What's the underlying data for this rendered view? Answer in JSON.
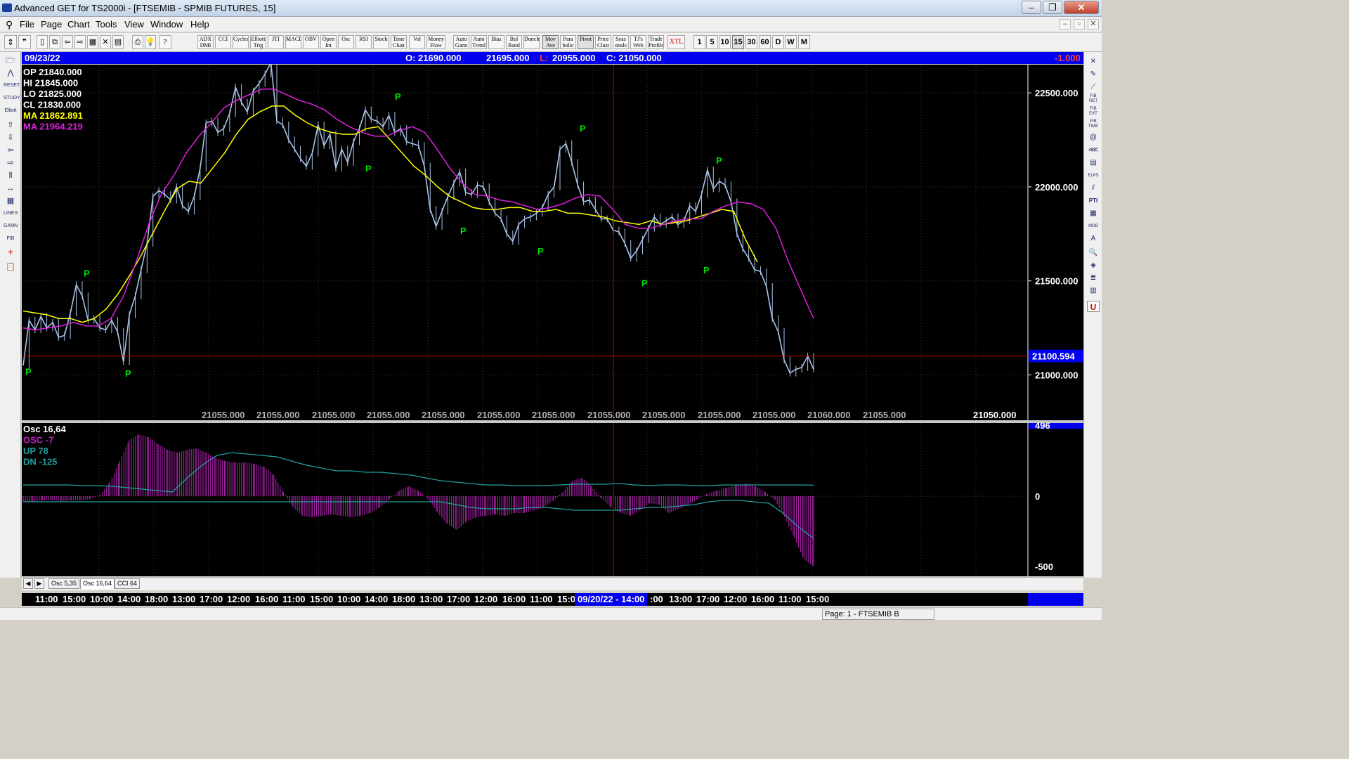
{
  "window": {
    "title": "Advanced GET for TS2000i - [FTSEMIB - SPMIB FUTURES, 15]"
  },
  "menu": [
    "File",
    "Page",
    "Chart",
    "Tools",
    "View",
    "Window",
    "Help"
  ],
  "toolbar": {
    "indicators": [
      "ADX DMI",
      "CCI",
      "Cycles",
      "Elliott Trig",
      "JTI",
      "MACD",
      "OBV",
      "Open Int",
      "Osc",
      "RSI",
      "Stoch",
      "Time Clust",
      "Vol",
      "Money Flow",
      "Auto Gann",
      "Auto Trend",
      "Bias",
      "Bol Band",
      "Donch",
      "Mov Ave",
      "Para bolic",
      "Pivot",
      "Price Clust",
      "Seas onals",
      "TJ's Web",
      "Trade Profile",
      "XTL"
    ],
    "intervals": [
      "1",
      "5",
      "10",
      "15",
      "30",
      "60",
      "D",
      "W",
      "M"
    ],
    "active_interval": "15"
  },
  "infobar": {
    "date": "09/23/22",
    "open": "O: 21690.000",
    "high": "21695.000",
    "low_label": "L:",
    "low_value": "20955.000",
    "close": "C: 21050.000",
    "change": "-1.000"
  },
  "legend": {
    "op": "OP  21840.000",
    "hi": "HI   21845.000",
    "lo": "LO  21825.000",
    "cl": "CL  21830.000",
    "ma1": "MA  21862.891",
    "ma2": "MA  21964.219"
  },
  "colors": {
    "price": "#a9c4e8",
    "ma_fast": "#ffff00",
    "ma_slow": "#e020e0",
    "pivot": "#00e000",
    "hist": "#a020a0",
    "band": "#20a0a0",
    "cursor": "#c00000"
  },
  "chart_data": [
    {
      "type": "line",
      "title": "FTSEMIB - SPMIB FUTURES, 15",
      "ylim": [
        20800,
        22650
      ],
      "yticks": [
        "22500.000",
        "22000.000",
        "21500.000",
        "21000.000"
      ],
      "ytick_values": [
        22500,
        22000,
        21500,
        21000
      ],
      "cursor_price_label": "21100.594",
      "cursor_price": 21100.594,
      "bottom_labels": [
        "21055.000",
        "21055.000",
        "21055.000",
        "21055.000",
        "21055.000",
        "21055.000",
        "21055.000",
        "21055.000",
        "21055.000",
        "21055.000",
        "21055.000",
        "21060.000",
        "21055.000",
        "21050.000"
      ],
      "series": [
        {
          "name": "",
          "values": [
            21050,
            21290,
            21240,
            21310,
            21250,
            21280,
            21200,
            21210,
            21330,
            21480,
            21420,
            21290,
            21300,
            21250,
            21240,
            21290,
            21230,
            21070,
            21320,
            21420,
            21560,
            21700,
            21950,
            21980,
            21960,
            21930,
            22000,
            21900,
            21870,
            21950,
            22100,
            22340,
            22350,
            22290,
            22310,
            22390,
            22530,
            22450,
            22400,
            22510,
            22550,
            22600,
            22660,
            22350,
            22330,
            22250,
            22200,
            22150,
            22110,
            22180,
            22330,
            22220,
            22280,
            22100,
            22200,
            22130,
            22240,
            22310,
            22410,
            22360,
            22350,
            22320,
            22380,
            22290,
            22310,
            22240,
            22230,
            22220,
            22110,
            21880,
            21790,
            21870,
            21950,
            22020,
            22080,
            21970,
            21960,
            22010,
            22000,
            21920,
            21860,
            21830,
            21750,
            21710,
            21800,
            21830,
            21840,
            21860,
            21890,
            21960,
            22000,
            22200,
            22230,
            22130,
            22010,
            21920,
            21930,
            21880,
            21830,
            21830,
            21770,
            21760,
            21700,
            21620,
            21660,
            21720,
            21780,
            21840,
            21800,
            21820,
            21840,
            21800,
            21820,
            21900,
            21870,
            21960,
            22090,
            21990,
            22030,
            22010,
            21920,
            21750,
            21670,
            21620,
            21560,
            21550,
            21470,
            21300,
            21230,
            21080,
            21010,
            21030,
            21040,
            21100,
            21030
          ]
        },
        {
          "name": "",
          "values": [
            21340,
            21330,
            21320,
            21300,
            21300,
            21280,
            21300,
            21350,
            21430,
            21530,
            21640,
            21760,
            21880,
            21990,
            22030,
            22020,
            22100,
            22180,
            22280,
            22360,
            22400,
            22430,
            22430,
            22380,
            22340,
            22310,
            22290,
            22280,
            22280,
            22310,
            22320,
            22250,
            22180,
            22110,
            22060,
            22000,
            21950,
            21920,
            21890,
            21880,
            21880,
            21890,
            21890,
            21870,
            21870,
            21880,
            21860,
            21860,
            21850,
            21840,
            21820,
            21810,
            21800,
            21820,
            21800,
            21810,
            21820,
            21840,
            21860,
            21880,
            21870,
            21720,
            21600
          ]
        },
        {
          "name": "",
          "values": [
            21250,
            21240,
            21250,
            21260,
            21280,
            21260,
            21260,
            21300,
            21420,
            21600,
            21800,
            21960,
            22060,
            22180,
            22270,
            22340,
            22420,
            22460,
            22490,
            22520,
            22520,
            22490,
            22460,
            22440,
            22410,
            22360,
            22320,
            22290,
            22270,
            22270,
            22300,
            22320,
            22290,
            22200,
            22100,
            22020,
            21960,
            21950,
            21930,
            21920,
            21900,
            21880,
            21890,
            21910,
            21940,
            21960,
            21950,
            21880,
            21800,
            21780,
            21780,
            21800,
            21820,
            21830,
            21830,
            21870,
            21900,
            21920,
            21910,
            21880,
            21780,
            21600,
            21450,
            21300
          ]
        }
      ],
      "pivots": [
        {
          "label": "P",
          "value": 21060,
          "pos": "below"
        },
        {
          "label": "P",
          "value": 21500,
          "pos": "above"
        },
        {
          "label": "P",
          "value": 21050,
          "pos": "below"
        },
        {
          "label": "P",
          "value": 22650,
          "pos": "above"
        },
        {
          "label": "P",
          "value": 22140,
          "pos": "below"
        },
        {
          "label": "P",
          "value": 22440,
          "pos": "above"
        },
        {
          "label": "P",
          "value": 21810,
          "pos": "below"
        },
        {
          "label": "P",
          "value": 21700,
          "pos": "below"
        },
        {
          "label": "P",
          "value": 22270,
          "pos": "above"
        },
        {
          "label": "P",
          "value": 21530,
          "pos": "below"
        },
        {
          "label": "P",
          "value": 21600,
          "pos": "below"
        },
        {
          "label": "P",
          "value": 22100,
          "pos": "above"
        }
      ]
    },
    {
      "type": "bar",
      "title": "Osc 16,64",
      "labels": {
        "osc": "OSC -7",
        "up": "UP  78",
        "dn": "DN   -125"
      },
      "ylim": [
        -550,
        500
      ],
      "yticks": [
        "496",
        "0",
        "-500"
      ],
      "ytick_values": [
        496,
        0,
        -500
      ],
      "series": [
        {
          "name": "OSC",
          "values": [
            -40,
            -40,
            -30,
            -30,
            -35,
            -30,
            -30,
            -20,
            10,
            100,
            250,
            400,
            440,
            420,
            370,
            330,
            310,
            330,
            340,
            310,
            270,
            250,
            240,
            240,
            230,
            210,
            150,
            30,
            -80,
            -140,
            -150,
            -140,
            -130,
            -140,
            -150,
            -140,
            -120,
            -80,
            -20,
            40,
            70,
            40,
            -20,
            -120,
            -200,
            -240,
            -180,
            -150,
            -140,
            -130,
            -140,
            -120,
            -120,
            -100,
            -80,
            -30,
            30,
            110,
            130,
            70,
            -20,
            -80,
            -120,
            -140,
            -100,
            -50,
            -60,
            -120,
            -90,
            -60,
            -20,
            20,
            40,
            60,
            80,
            90,
            70,
            30,
            -30,
            -150,
            -300,
            -450,
            -500
          ]
        },
        {
          "name": "UP",
          "values": [
            80,
            80,
            80,
            80,
            75,
            75,
            70,
            60,
            50,
            40,
            30,
            130,
            220,
            290,
            310,
            300,
            290,
            280,
            250,
            220,
            200,
            180,
            180,
            170,
            170,
            160,
            150,
            130,
            110,
            100,
            90,
            80,
            80,
            75,
            75,
            75,
            80,
            85,
            85,
            85,
            90,
            80,
            75,
            80,
            80,
            75,
            75,
            80,
            80,
            80,
            80,
            80,
            80,
            78
          ]
        },
        {
          "name": "DN",
          "values": [
            -40,
            -40,
            -40,
            -40,
            -40,
            -40,
            -40,
            -40,
            -40,
            -40,
            -40,
            -40,
            -40,
            -40,
            -40,
            -40,
            -40,
            -40,
            -40,
            -40,
            -40,
            -40,
            -40,
            -40,
            -40,
            -40,
            -40,
            -40,
            -40,
            -60,
            -80,
            -90,
            -90,
            -90,
            -80,
            -80,
            -90,
            -100,
            -100,
            -100,
            -100,
            -90,
            -80,
            -80,
            -70,
            -60,
            -40,
            -30,
            -30,
            -40,
            -50,
            -125,
            -220,
            -300
          ]
        }
      ]
    }
  ],
  "tabs": [
    "Osc 5,35",
    "Osc 16,64",
    "CCI 64"
  ],
  "active_tab": "Osc 16,64",
  "timebar": {
    "ticks": [
      "11:00",
      "15:00",
      "10:00",
      "14:00",
      "18:00",
      "13:00",
      "17:00",
      "12:00",
      "16:00",
      "11:00",
      "15:00",
      "10:00",
      "14:00",
      "18:00",
      "13:00",
      "17:00",
      "12:00",
      "16:00",
      "11:00",
      "15:0",
      "",
      ":00",
      "13:00",
      "17:00",
      "12:00",
      "16:00",
      "11:00",
      "15:00"
    ],
    "cursor_label": "09/20/22 - 14:00"
  },
  "statusbar": {
    "page": "Page: 1 - FTSEMIB B"
  }
}
